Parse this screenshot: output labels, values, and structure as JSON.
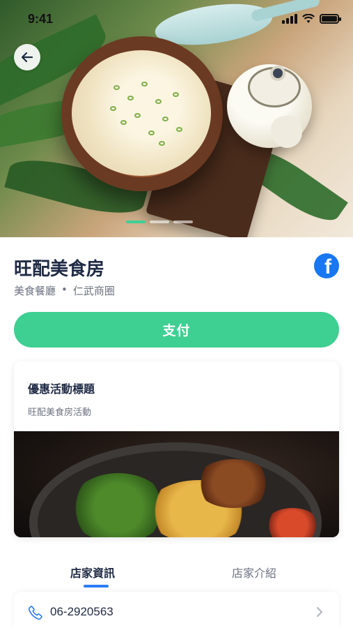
{
  "status_bar": {
    "time": "9:41"
  },
  "hero": {
    "carousel_total": 3,
    "carousel_active": 0
  },
  "store": {
    "name": "旺配美食房",
    "category": "美食餐廳",
    "separator": "•",
    "area": "仁武商圈",
    "social": "f"
  },
  "pay_button": {
    "label": "支付"
  },
  "promo": {
    "title": "優惠活動標題",
    "subtitle": "旺配美食房活動"
  },
  "tabs": [
    {
      "label": "店家資訊",
      "active": true
    },
    {
      "label": "店家介紹",
      "active": false
    }
  ],
  "contact": {
    "phone": "06-2920563"
  },
  "colors": {
    "accent": "#3ecf92",
    "tab_indicator": "#2f7cf6",
    "facebook": "#1877f2",
    "title": "#1f2a44"
  }
}
